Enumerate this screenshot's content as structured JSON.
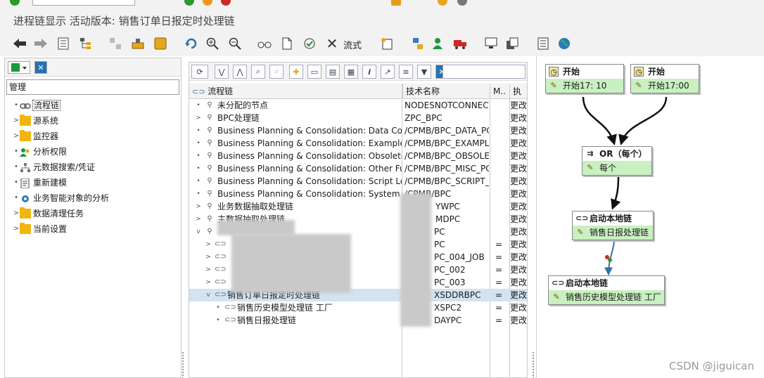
{
  "window": {
    "title": "进程链显示 活动版本: 销售订单日报定时处理链"
  },
  "toolbar": {
    "process_type_label": "流式"
  },
  "left": {
    "header": "管理",
    "items": [
      {
        "label": "流程链",
        "icon": "chain-icon",
        "selected": true,
        "expandable": false
      },
      {
        "label": "源系统",
        "icon": "folder-icon",
        "expandable": true
      },
      {
        "label": "监控器",
        "icon": "folder-icon",
        "expandable": true
      },
      {
        "label": "分析权限",
        "icon": "users-icon",
        "expandable": false
      },
      {
        "label": "元数据搜索/凭证",
        "icon": "tree-icon",
        "expandable": false
      },
      {
        "label": "重新建模",
        "icon": "document-icon",
        "expandable": false
      },
      {
        "label": "业务智能对象的分析",
        "icon": "gear-icon",
        "expandable": false
      },
      {
        "label": "数据清理任务",
        "icon": "folder-icon",
        "expandable": true
      },
      {
        "label": "当前设置",
        "icon": "folder-icon",
        "expandable": true
      }
    ]
  },
  "middle": {
    "columns": {
      "name": "流程链",
      "tech": "技术名称",
      "m": "M..",
      "exec": "执"
    },
    "rows": [
      {
        "name": "未分配的节点",
        "tech": "NODESNOTCONNECTED",
        "m": "",
        "exec": "更改",
        "level": 0,
        "toggle": "•",
        "icon": "tree-icon"
      },
      {
        "name": "BPC处理链",
        "tech": "ZPC_BPC",
        "m": "",
        "exec": "更改",
        "level": 0,
        "toggle": ">",
        "icon": "tree-icon"
      },
      {
        "name": "Business Planning & Consolidation: Data Collection",
        "tech": "/CPMB/BPC_DATA_PC",
        "m": "",
        "exec": "更改",
        "level": 0,
        "toggle": "•",
        "icon": "tree-icon"
      },
      {
        "name": "Business Planning & Consolidation: Examples",
        "tech": "/CPMB/BPC_EXAMPLE",
        "m": "",
        "exec": "更改",
        "level": 0,
        "toggle": "•",
        "icon": "tree-icon"
      },
      {
        "name": "Business Planning & Consolidation: Obsolete Functions",
        "tech": "/CPMB/BPC_OBSOLETE",
        "m": "",
        "exec": "更改",
        "level": 0,
        "toggle": "•",
        "icon": "tree-icon"
      },
      {
        "name": "Business Planning & Consolidation: Other Functions",
        "tech": "/CPMB/BPC_MISC_PC",
        "m": "",
        "exec": "更改",
        "level": 0,
        "toggle": "•",
        "icon": "tree-icon"
      },
      {
        "name": "Business Planning & Consolidation: Script Logic",
        "tech": "/CPMB/BPC_SCRIPT_PC",
        "m": "",
        "exec": "更改",
        "level": 0,
        "toggle": "•",
        "icon": "tree-icon"
      },
      {
        "name": "Business Planning & Consolidation: System",
        "tech": "/CPMB/BPC",
        "m": "",
        "exec": "更改",
        "level": 0,
        "toggle": "•",
        "icon": "tree-icon"
      },
      {
        "name": "业务数据抽取处理链",
        "tech": "YWPC",
        "m": "",
        "exec": "更改",
        "level": 0,
        "toggle": ">",
        "icon": "tree-icon"
      },
      {
        "name": "主数据抽取处理链",
        "tech": "MDPC",
        "m": "",
        "exec": "更改",
        "level": 0,
        "toggle": ">",
        "icon": "tree-icon"
      },
      {
        "name": "",
        "tech": "PC",
        "m": "",
        "exec": "更改",
        "level": 0,
        "toggle": "v",
        "icon": "tree-icon"
      },
      {
        "name": "",
        "tech": "PC",
        "m": "=",
        "exec": "更改",
        "level": 1,
        "toggle": ">",
        "icon": "chain-icon"
      },
      {
        "name": "",
        "tech": "PC_004_JOB",
        "m": "=",
        "exec": "更改",
        "level": 1,
        "toggle": ">",
        "icon": "chain-icon"
      },
      {
        "name": "",
        "tech": "PC_002",
        "m": "=",
        "exec": "更改",
        "level": 1,
        "toggle": ">",
        "icon": "chain-icon"
      },
      {
        "name": "",
        "tech": "PC_003",
        "m": "=",
        "exec": "更改",
        "level": 1,
        "toggle": ">",
        "icon": "chain-icon"
      },
      {
        "name": "销售订单日报定时处理链",
        "tech": "XSDDRBPC",
        "m": "=",
        "exec": "更改",
        "level": 1,
        "toggle": "v",
        "icon": "chain-icon",
        "selected": true
      },
      {
        "name": "销售历史模型处理链 工厂",
        "tech": "XSPC2",
        "m": "=",
        "exec": "更改",
        "level": 2,
        "toggle": "•",
        "icon": "chain-icon"
      },
      {
        "name": "销售日报处理链",
        "tech": "DAYPC",
        "m": "=",
        "exec": "更改",
        "level": 2,
        "toggle": "•",
        "icon": "chain-icon"
      }
    ]
  },
  "diagram": {
    "start1": {
      "title": "开始",
      "sub": "开始17: 10"
    },
    "start2": {
      "title": "开始",
      "sub": "开始17:00"
    },
    "or": {
      "title": "OR（每个）",
      "sub": "每个"
    },
    "local1": {
      "title": "启动本地链",
      "sub": "销售日报处理链"
    },
    "local2": {
      "title": "启动本地链",
      "sub": "销售历史模型处理链 工厂"
    },
    "colors": {
      "node_body": "#c8f0c0",
      "link_dark": "#111111",
      "link_blue": "#3b6fa8"
    }
  },
  "watermark": "CSDN @jiguican"
}
